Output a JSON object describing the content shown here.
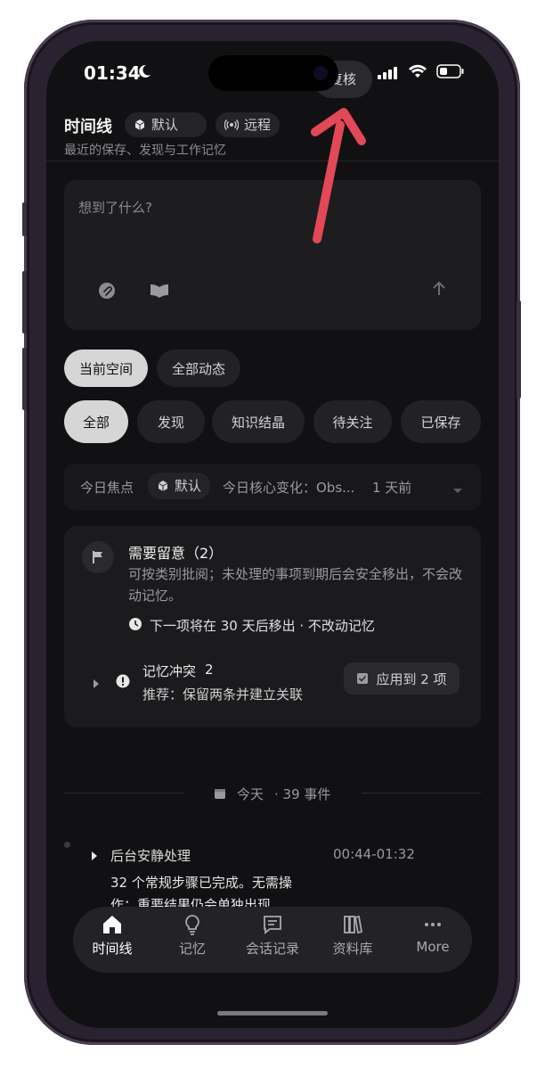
{
  "status": {
    "time": "01:34",
    "review_label": "复核"
  },
  "header": {
    "title": "时间线",
    "space_chip": "默认",
    "remote_chip": "远程",
    "subtitle": "最近的保存、发现与工作记忆"
  },
  "composer": {
    "placeholder": "想到了什么?"
  },
  "scope_tabs": [
    {
      "label": "当前空间"
    },
    {
      "label": "全部动态"
    }
  ],
  "filters": [
    {
      "label": "全部"
    },
    {
      "label": "发现"
    },
    {
      "label": "知识结晶"
    },
    {
      "label": "待关注"
    },
    {
      "label": "已保存"
    }
  ],
  "focus": {
    "label": "今日焦点",
    "space": "默认",
    "summary": "今日核心变化：Obs...",
    "time": "1 天前"
  },
  "attention": {
    "title": "需要留意（2）",
    "description": "可按类别批阅；未处理的事项到期后会安全移出，不会改动记忆。",
    "next": "下一项将在 30 天后移出 · 不改动记忆",
    "conflict_title": "记忆冲突",
    "conflict_count": "2",
    "conflict_recommend": "推荐：保留两条并建立关联",
    "apply_button": "应用到 2 项"
  },
  "day": {
    "label": "今天",
    "events": "· 39 事件"
  },
  "event": {
    "title": "后台安静处理",
    "time": "00:44-01:32",
    "body_line1": "32 个常规步骤已完成。无需操",
    "body_line2": "作；重要结果仍会单独出现"
  },
  "nav": [
    {
      "label": "时间线",
      "icon": "home-icon"
    },
    {
      "label": "记忆",
      "icon": "lightbulb-icon"
    },
    {
      "label": "会话记录",
      "icon": "chat-icon"
    },
    {
      "label": "资料库",
      "icon": "books-icon"
    },
    {
      "label": "More",
      "icon": "more-icon"
    }
  ],
  "colors": {
    "background": "#111113",
    "accent_active": "#d6d6d6",
    "arrow": "#e24858"
  }
}
